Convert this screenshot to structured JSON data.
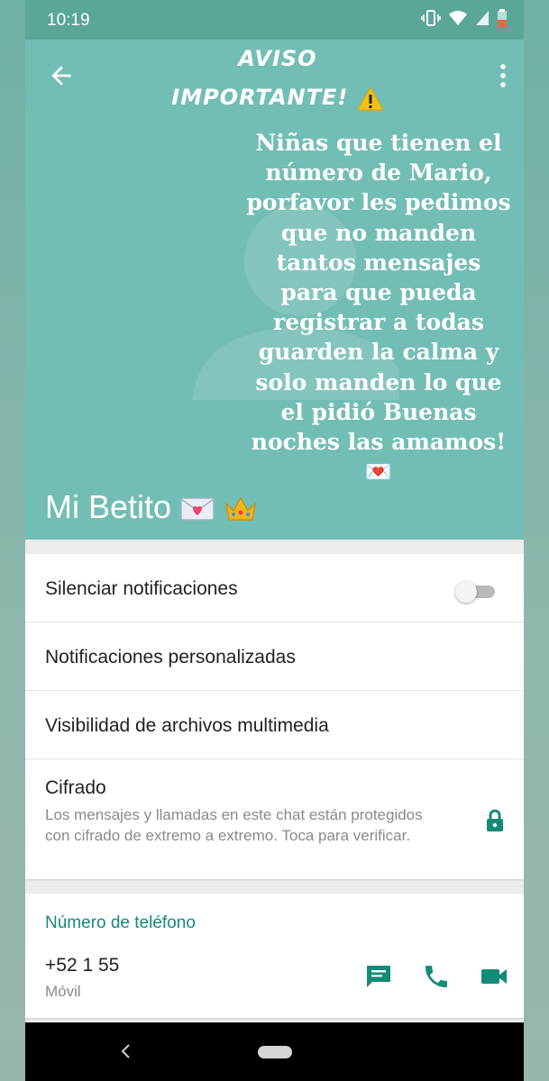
{
  "statusbar": {
    "time": "10:19"
  },
  "story": {
    "heading": "AVISO IMPORTANTE!⚠️",
    "heading_line1": "AVISO",
    "heading_line2": "IMPORTANTE!",
    "body": "Niñas que tienen el número de Mario, porfavor les pedimos que no manden tantos mensajes para que pueda registrar a todas guarden la calma y solo manden lo que el pidió Buenas noches las amamos!💌"
  },
  "contact": {
    "name": "Mi Betito 💌👑",
    "name_text": "Mi Betito"
  },
  "settings": {
    "mute_label": "Silenciar notificaciones",
    "mute_enabled": false,
    "custom_notifications_label": "Notificaciones personalizadas",
    "media_visibility_label": "Visibilidad de archivos multimedia",
    "encryption_label": "Cifrado",
    "encryption_desc": "Los mensajes y llamadas en este chat están protegidos con cifrado de extremo a extremo. Toca para verificar."
  },
  "phone": {
    "section_title": "Número de teléfono",
    "number": "+52 1 55",
    "type": "Móvil"
  },
  "colors": {
    "header_bg": "#73beb4",
    "accent": "#138b78",
    "statusbar_bg": "#5aa79a"
  },
  "icons": [
    "back-arrow-icon",
    "more-vert-icon",
    "lock-icon",
    "message-icon",
    "phone-icon",
    "videocam-icon",
    "warning-icon",
    "love-letter-icon",
    "crown-icon",
    "vibrate-icon",
    "wifi-icon",
    "signal-icon",
    "battery-icon"
  ]
}
